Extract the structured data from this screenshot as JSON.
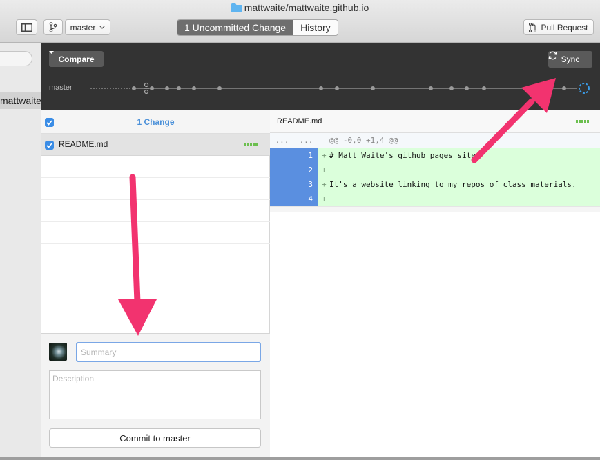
{
  "window": {
    "title": "mattwaite/mattwaite.github.io",
    "branch_select": "master",
    "tabs": [
      {
        "label": "1 Uncommitted Change",
        "active": true
      },
      {
        "label": "History",
        "active": false
      }
    ],
    "pull_request_label": "Pull Request"
  },
  "sidebar": {
    "repo_item_label": "mattwaite.github.io"
  },
  "timeline": {
    "compare_label": "Compare",
    "sync_label": "Sync",
    "branch_label": "master"
  },
  "changes": {
    "count_label": "1 Change",
    "files": [
      {
        "name": "README.md",
        "checked": true
      }
    ]
  },
  "commit": {
    "summary_placeholder": "Summary",
    "description_placeholder": "Description",
    "commit_button_label": "Commit to master"
  },
  "diff": {
    "filename": "README.md",
    "hunk_gutter": "...",
    "hunk_header": "@@ -0,0 +1,4 @@",
    "lines": [
      {
        "num": "1",
        "text": "# Matt Waite's github pages site"
      },
      {
        "num": "2",
        "text": ""
      },
      {
        "num": "3",
        "text": "It's a website linking to my repos of class materials."
      },
      {
        "num": "4",
        "text": ""
      }
    ]
  },
  "colors": {
    "accent_blue": "#3b8de6",
    "added_bg": "#dbffdb",
    "annotation_arrow": "#f2336f",
    "timeline_bg": "#333333"
  }
}
